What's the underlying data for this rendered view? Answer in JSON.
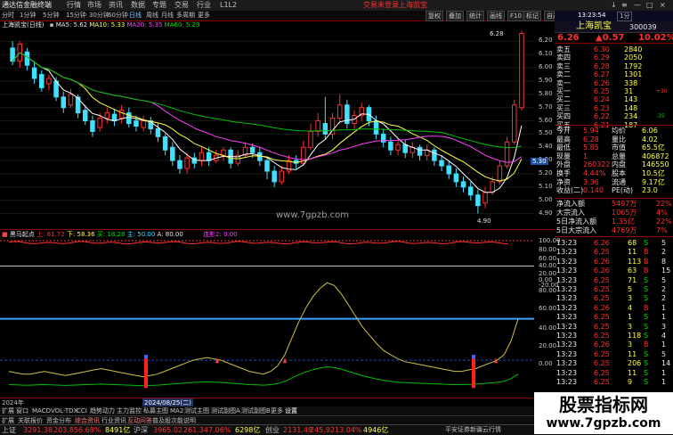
{
  "app": {
    "title": "通达信金融终端",
    "menus": [
      "行情",
      "市场",
      "资讯",
      "数据",
      "专题",
      "交易",
      "行业",
      "L1L2"
    ],
    "promo": [
      "交易未登录",
      "上海凯宝"
    ],
    "window_controls": [
      "↓",
      "≡",
      "—",
      "□",
      "×"
    ]
  },
  "toolbar": {
    "periods": [
      "分时",
      "1分钟",
      "5分钟",
      "15分钟",
      "30分钟",
      "60分钟",
      "日线",
      "周线",
      "月线",
      "多周期",
      "更多"
    ],
    "active_period": "日线",
    "right_buttons": [
      "复权",
      "叠加",
      "统计",
      "画线",
      "F10",
      "标记",
      "自选",
      "返回"
    ]
  },
  "stock": {
    "name_code": "上海凯宝(日线)",
    "name": "上海凯宝",
    "code": "300039"
  },
  "main_legend": {
    "ma5": "MA5: 5.62",
    "ma10": "MA10: 5.33",
    "ma20": "MA20: 5.35",
    "ma60": "MA60: 5.29"
  },
  "main_axis": [
    "6.20",
    "6.10",
    "6.00",
    "5.90",
    "5.80",
    "5.70",
    "5.60",
    "5.50",
    "5.40",
    "5.30",
    "5.20",
    "5.10",
    "5.00",
    "4.90"
  ],
  "price_marks": {
    "high": "6.28",
    "low": "4.90",
    "current": "5.30"
  },
  "watermark": "www.7gpzb.com",
  "indicator": {
    "name": "黑马起点",
    "params": [
      "上: 81.72",
      "下: 58.36",
      "买: 18.28",
      "主: 50.00",
      "A: 80.00",
      "连影2: 0.00"
    ],
    "axis": [
      "100.00",
      "80.00",
      "60.00",
      "40.00",
      "20.00",
      "0.00",
      "-20.00",
      "80.00",
      "60.00",
      "40.00",
      "20.00",
      "0.00"
    ]
  },
  "chart_data": {
    "type": "candlestick",
    "ma_legend": [
      "MA5: 5.62",
      "MA10: 5.33",
      "MA20: 5.35",
      "MA60: 5.29"
    ],
    "ylim": [
      4.85,
      6.25
    ],
    "candles": [
      {
        "o": 6.15,
        "c": 6.05,
        "h": 6.2,
        "l": 6.02
      },
      {
        "o": 6.05,
        "c": 6.18,
        "h": 6.2,
        "l": 6.0
      },
      {
        "o": 6.12,
        "c": 6.02,
        "h": 6.15,
        "l": 5.98
      },
      {
        "o": 6.0,
        "c": 5.92,
        "h": 6.05,
        "l": 5.88
      },
      {
        "o": 5.95,
        "c": 5.85,
        "h": 5.98,
        "l": 5.82
      },
      {
        "o": 5.88,
        "c": 5.92,
        "h": 5.95,
        "l": 5.83
      },
      {
        "o": 5.9,
        "c": 5.78,
        "h": 5.93,
        "l": 5.75
      },
      {
        "o": 5.78,
        "c": 5.7,
        "h": 5.82,
        "l": 5.66
      },
      {
        "o": 5.72,
        "c": 5.8,
        "h": 5.84,
        "l": 5.7
      },
      {
        "o": 5.78,
        "c": 5.66,
        "h": 5.8,
        "l": 5.62
      },
      {
        "o": 5.68,
        "c": 5.6,
        "h": 5.72,
        "l": 5.57
      },
      {
        "o": 5.6,
        "c": 5.52,
        "h": 5.64,
        "l": 5.48
      },
      {
        "o": 5.55,
        "c": 5.62,
        "h": 5.66,
        "l": 5.52
      },
      {
        "o": 5.62,
        "c": 5.66,
        "h": 5.7,
        "l": 5.58
      },
      {
        "o": 5.65,
        "c": 5.6,
        "h": 5.69,
        "l": 5.56
      },
      {
        "o": 5.62,
        "c": 5.68,
        "h": 5.72,
        "l": 5.58
      },
      {
        "o": 5.66,
        "c": 5.58,
        "h": 5.7,
        "l": 5.55
      },
      {
        "o": 5.6,
        "c": 5.56,
        "h": 5.64,
        "l": 5.52
      },
      {
        "o": 5.55,
        "c": 5.6,
        "h": 5.64,
        "l": 5.52
      },
      {
        "o": 5.6,
        "c": 5.54,
        "h": 5.63,
        "l": 5.5
      },
      {
        "o": 5.54,
        "c": 5.48,
        "h": 5.58,
        "l": 5.44
      },
      {
        "o": 5.48,
        "c": 5.38,
        "h": 5.5,
        "l": 5.34
      },
      {
        "o": 5.4,
        "c": 5.3,
        "h": 5.44,
        "l": 5.26
      },
      {
        "o": 5.3,
        "c": 5.24,
        "h": 5.34,
        "l": 5.2
      },
      {
        "o": 5.24,
        "c": 5.32,
        "h": 5.36,
        "l": 5.2
      },
      {
        "o": 5.32,
        "c": 5.28,
        "h": 5.36,
        "l": 5.24
      },
      {
        "o": 5.3,
        "c": 5.36,
        "h": 5.4,
        "l": 5.26
      },
      {
        "o": 5.36,
        "c": 5.3,
        "h": 5.4,
        "l": 5.26
      },
      {
        "o": 5.3,
        "c": 5.34,
        "h": 5.38,
        "l": 5.28
      },
      {
        "o": 5.34,
        "c": 5.38,
        "h": 5.4,
        "l": 5.3
      },
      {
        "o": 5.38,
        "c": 5.28,
        "h": 5.4,
        "l": 5.24
      },
      {
        "o": 5.28,
        "c": 5.34,
        "h": 5.38,
        "l": 5.26
      },
      {
        "o": 5.34,
        "c": 5.4,
        "h": 5.44,
        "l": 5.32
      },
      {
        "o": 5.4,
        "c": 5.36,
        "h": 5.43,
        "l": 5.32
      },
      {
        "o": 5.36,
        "c": 5.3,
        "h": 5.4,
        "l": 5.26
      },
      {
        "o": 5.3,
        "c": 5.22,
        "h": 5.32,
        "l": 5.16
      },
      {
        "o": 5.22,
        "c": 5.14,
        "h": 5.26,
        "l": 5.1
      },
      {
        "o": 5.14,
        "c": 5.22,
        "h": 5.26,
        "l": 5.12
      },
      {
        "o": 5.22,
        "c": 5.3,
        "h": 5.34,
        "l": 5.2
      },
      {
        "o": 5.3,
        "c": 5.28,
        "h": 5.34,
        "l": 5.24
      },
      {
        "o": 5.28,
        "c": 5.4,
        "h": 5.45,
        "l": 5.26
      },
      {
        "o": 5.4,
        "c": 5.52,
        "h": 5.58,
        "l": 5.38
      },
      {
        "o": 5.52,
        "c": 5.6,
        "h": 5.66,
        "l": 5.48
      },
      {
        "o": 5.58,
        "c": 5.5,
        "h": 5.78,
        "l": 5.46
      },
      {
        "o": 5.5,
        "c": 5.62,
        "h": 5.66,
        "l": 5.46
      },
      {
        "o": 5.62,
        "c": 5.72,
        "h": 5.8,
        "l": 5.58
      },
      {
        "o": 5.72,
        "c": 5.58,
        "h": 5.76,
        "l": 5.54
      },
      {
        "o": 5.58,
        "c": 5.64,
        "h": 5.68,
        "l": 5.54
      },
      {
        "o": 5.64,
        "c": 5.7,
        "h": 5.74,
        "l": 5.6
      },
      {
        "o": 5.7,
        "c": 5.6,
        "h": 5.72,
        "l": 5.56
      },
      {
        "o": 5.6,
        "c": 5.5,
        "h": 5.64,
        "l": 5.46
      },
      {
        "o": 5.5,
        "c": 5.44,
        "h": 5.54,
        "l": 5.4
      },
      {
        "o": 5.44,
        "c": 5.38,
        "h": 5.48,
        "l": 5.34
      },
      {
        "o": 5.38,
        "c": 5.42,
        "h": 5.46,
        "l": 5.34
      },
      {
        "o": 5.42,
        "c": 5.36,
        "h": 5.46,
        "l": 5.32
      },
      {
        "o": 5.36,
        "c": 5.4,
        "h": 5.44,
        "l": 5.32
      },
      {
        "o": 5.4,
        "c": 5.34,
        "h": 5.42,
        "l": 5.3
      },
      {
        "o": 5.34,
        "c": 5.38,
        "h": 5.42,
        "l": 5.3
      },
      {
        "o": 5.38,
        "c": 5.3,
        "h": 5.4,
        "l": 5.26
      },
      {
        "o": 5.3,
        "c": 5.26,
        "h": 5.34,
        "l": 5.22
      },
      {
        "o": 5.26,
        "c": 5.2,
        "h": 5.3,
        "l": 5.16
      },
      {
        "o": 5.2,
        "c": 5.14,
        "h": 5.24,
        "l": 5.1
      },
      {
        "o": 5.14,
        "c": 5.1,
        "h": 5.18,
        "l": 5.06
      },
      {
        "o": 5.1,
        "c": 5.04,
        "h": 5.14,
        "l": 5.0
      },
      {
        "o": 5.04,
        "c": 4.96,
        "h": 5.08,
        "l": 4.9
      },
      {
        "o": 4.98,
        "c": 5.06,
        "h": 5.1,
        "l": 4.94
      },
      {
        "o": 5.06,
        "c": 5.14,
        "h": 5.18,
        "l": 5.04
      },
      {
        "o": 5.14,
        "c": 5.26,
        "h": 5.3,
        "l": 5.12
      },
      {
        "o": 5.26,
        "c": 5.44,
        "h": 5.48,
        "l": 5.24
      },
      {
        "o": 5.44,
        "c": 5.72,
        "h": 5.76,
        "l": 5.42
      },
      {
        "o": 5.7,
        "c": 6.26,
        "h": 6.28,
        "l": 5.68
      }
    ]
  },
  "quote": {
    "price": "6.26",
    "change": "▲0.57",
    "pct": "10.02%",
    "asks": [
      {
        "label": "卖五",
        "price": "6.30",
        "vol": "2840"
      },
      {
        "label": "卖四",
        "price": "6.29",
        "vol": "2050"
      },
      {
        "label": "卖三",
        "price": "6.28",
        "vol": "1792"
      },
      {
        "label": "卖二",
        "price": "6.27",
        "vol": "1301"
      },
      {
        "label": "卖一",
        "price": "6.26",
        "vol": "338"
      }
    ],
    "bids": [
      {
        "label": "买一",
        "price": "6.25",
        "vol": "31",
        "d": "+30"
      },
      {
        "label": "买二",
        "price": "6.24",
        "vol": "143",
        "d": ""
      },
      {
        "label": "买三",
        "price": "6.23",
        "vol": "148",
        "d": ""
      },
      {
        "label": "买四",
        "price": "6.22",
        "vol": "234",
        "d": "-35"
      },
      {
        "label": "买五",
        "price": "6.21",
        "vol": "187",
        "d": ""
      }
    ],
    "stats": [
      {
        "l1": "今开",
        "v1": "5.94",
        "l2": "均价",
        "v2": "6.06"
      },
      {
        "l1": "最高",
        "v1": "6.28",
        "l2": "量比",
        "v2": "4.02"
      },
      {
        "l1": "最低",
        "v1": "5.85",
        "l2": "市值",
        "v2": "65.5亿"
      },
      {
        "l1": "现量",
        "v1": "1",
        "l2": "总量",
        "v2": "406872"
      },
      {
        "l1": "外盘",
        "v1": "260322",
        "l2": "内盘",
        "v2": "146550"
      },
      {
        "l1": "换手",
        "v1": "4.44%",
        "l2": "股本",
        "v2": "10.5亿"
      },
      {
        "l1": "净资",
        "v1": "3.36",
        "l2": "流通",
        "v2": "9.17亿"
      },
      {
        "l1": "收益(二)",
        "v1": "0.140",
        "l2": "PE(动)",
        "v2": "23.0"
      }
    ],
    "flows": [
      {
        "label": "净流入额",
        "value": "5497万",
        "pct": "22%"
      },
      {
        "label": "大宗流入",
        "value": "1065万",
        "pct": "4%"
      },
      {
        "label": "5日净流入额",
        "value": "1.35亿",
        "pct": "22%"
      },
      {
        "label": "5日大宗流入",
        "value": "4769万",
        "pct": "7%"
      }
    ]
  },
  "ticks": [
    {
      "t": "13:23",
      "p": "6.26",
      "v": "68",
      "s": "S",
      "n": "5"
    },
    {
      "t": "13:23",
      "p": "6.25",
      "v": "11",
      "s": "B",
      "n": "2"
    },
    {
      "t": "13:23",
      "p": "6.26",
      "v": "113",
      "s": "B",
      "n": "8"
    },
    {
      "t": "13:23",
      "p": "6.26",
      "v": "63",
      "s": "B",
      "n": "15"
    },
    {
      "t": "13:23",
      "p": "6.25",
      "v": "71",
      "s": "S",
      "n": "5"
    },
    {
      "t": "13:23",
      "p": "6.25",
      "v": "5",
      "s": "S",
      "n": "2"
    },
    {
      "t": "13:23",
      "p": "6.25",
      "v": "3",
      "s": "S",
      "n": "2"
    },
    {
      "t": "13:23",
      "p": "6.26",
      "v": "4",
      "s": "B",
      "n": "1"
    },
    {
      "t": "13:23",
      "p": "6.25",
      "v": "1",
      "s": "S",
      "n": "1"
    },
    {
      "t": "13:23",
      "p": "6.25",
      "v": "3",
      "s": "S",
      "n": "3"
    },
    {
      "t": "13:23",
      "p": "6.25",
      "v": "118",
      "s": "S",
      "n": "4"
    },
    {
      "t": "13:23",
      "p": "6.26",
      "v": "3",
      "s": "B",
      "n": "1"
    },
    {
      "t": "13:23",
      "p": "6.25",
      "v": "11",
      "s": "S",
      "n": "5"
    },
    {
      "t": "13:23",
      "p": "6.25",
      "v": "206",
      "s": "S",
      "n": "14"
    },
    {
      "t": "13:23",
      "p": "6.25",
      "v": "11",
      "s": "S",
      "n": "1"
    },
    {
      "t": "13:23",
      "p": "6.25",
      "v": "9",
      "s": "S",
      "n": "1"
    }
  ],
  "bottom_tabs": [
    "扩展",
    "关联报价",
    "资金分布",
    "综合资讯",
    "行业资讯",
    "互动问答",
    "普及股次能说明"
  ],
  "indicator_tabs": [
    "2024年",
    "2024/08/25(二)"
  ],
  "indicator_tab_row": [
    "扩展",
    "窗口",
    "MACD",
    "VOL-TDX",
    "CCI",
    "趋势动力",
    "主力监控",
    "私募主图",
    "MA2",
    "测试主图",
    "测试副图A",
    "测试副图B",
    "更多",
    "设置"
  ],
  "status": {
    "items": [
      {
        "label": "上证",
        "v": "3291.38",
        "c": "203.85",
        "p": "6.68%",
        "amt": "8491亿"
      },
      {
        "label": "沪深",
        "v": "3965.02",
        "c": "261.34",
        "p": "7.06%",
        "amt": "6298亿"
      },
      {
        "label": "创业",
        "v": "2131.48",
        "c": "245.92",
        "p": "13.04%",
        "amt": "4946亿"
      }
    ],
    "right": "平安证券新疆云行情"
  },
  "brand": {
    "cn": "股票指标网",
    "url": "www.7gpzb.com"
  },
  "clock": "13:23:54",
  "timebox": "1分"
}
